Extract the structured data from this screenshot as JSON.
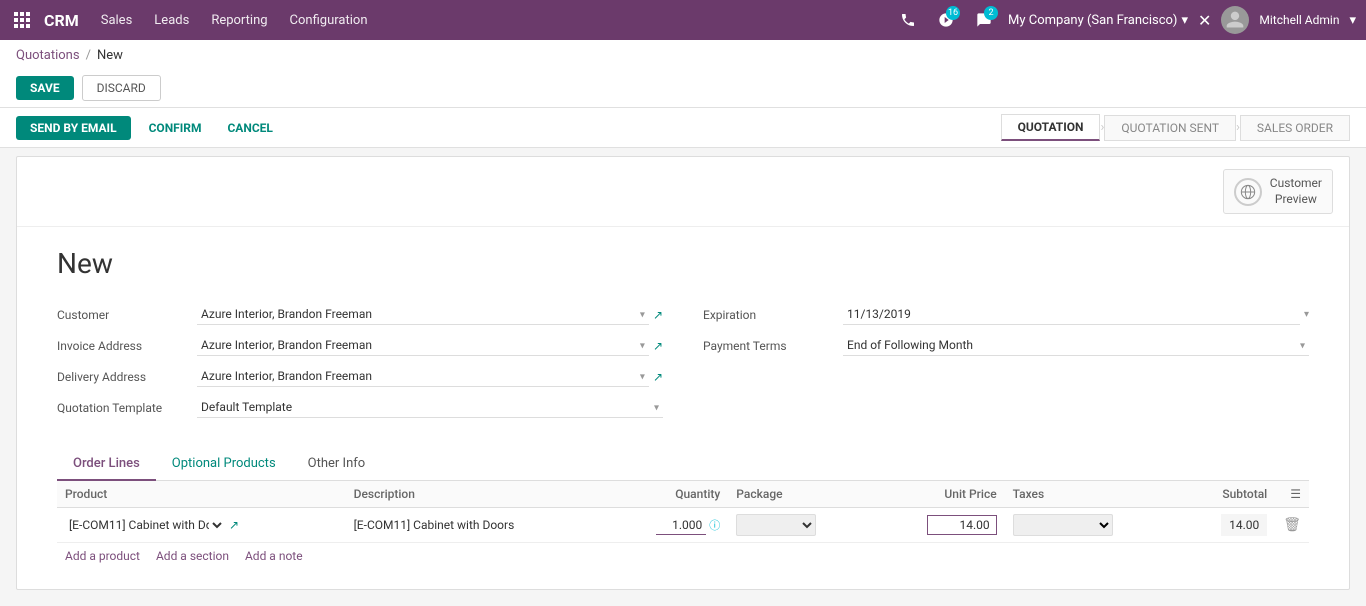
{
  "topnav": {
    "brand": "CRM",
    "menu": [
      "Sales",
      "Leads",
      "Reporting",
      "Configuration"
    ],
    "badge_activity": "16",
    "badge_messages": "2",
    "company": "My Company (San Francisco)",
    "user": "Mitchell Admin"
  },
  "breadcrumb": {
    "parent": "Quotations",
    "separator": "/",
    "current": "New"
  },
  "actions": {
    "save": "SAVE",
    "discard": "DISCARD",
    "send_email": "SEND BY EMAIL",
    "confirm": "CONFIRM",
    "cancel": "CANCEL"
  },
  "status_steps": [
    {
      "label": "QUOTATION",
      "active": true
    },
    {
      "label": "QUOTATION SENT",
      "active": false
    },
    {
      "label": "SALES ORDER",
      "active": false
    }
  ],
  "customer_preview": {
    "label": "Customer\nPreview"
  },
  "doc": {
    "title": "New",
    "customer_label": "Customer",
    "customer_value": "Azure Interior, Brandon Freeman",
    "invoice_address_label": "Invoice Address",
    "invoice_address_value": "Azure Interior, Brandon Freeman",
    "delivery_address_label": "Delivery Address",
    "delivery_address_value": "Azure Interior, Brandon Freeman",
    "quotation_template_label": "Quotation Template",
    "quotation_template_value": "Default Template",
    "expiration_label": "Expiration",
    "expiration_value": "11/13/2019",
    "payment_terms_label": "Payment Terms",
    "payment_terms_value": "End of Following Month"
  },
  "tabs": [
    {
      "label": "Order Lines",
      "active": true
    },
    {
      "label": "Optional Products",
      "active": false
    },
    {
      "label": "Other Info",
      "active": false
    }
  ],
  "table": {
    "columns": [
      "Product",
      "Description",
      "Quantity",
      "Package",
      "Unit Price",
      "Taxes",
      "Subtotal",
      ""
    ],
    "rows": [
      {
        "product": "[E-COM11] Cabinet with Do...",
        "description": "[E-COM11] Cabinet with Doors",
        "quantity": "1.000",
        "package": "",
        "unit_price": "14.00",
        "taxes": "",
        "subtotal": "14.00"
      }
    ],
    "add_product": "Add a product",
    "add_section": "Add a section",
    "add_note": "Add a note"
  }
}
